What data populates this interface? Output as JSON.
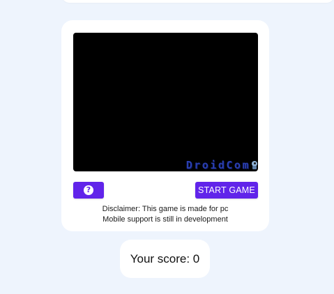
{
  "game": {
    "logo_text": "DroidCom",
    "logo_icon": "mascot-icon"
  },
  "controls": {
    "help_icon": "question-circle-icon",
    "help_symbol": "?",
    "start_label": "START GAME"
  },
  "disclaimer": {
    "line1": "Disclaimer: This game is made for pc",
    "line2": "Mobile support is still in development"
  },
  "score": {
    "label": "Your score: 0"
  },
  "colors": {
    "page_background": "#eef4fd",
    "card_background": "#ffffff",
    "accent": "#6124ea",
    "canvas": "#000000",
    "logo": "#2a3fb0"
  }
}
